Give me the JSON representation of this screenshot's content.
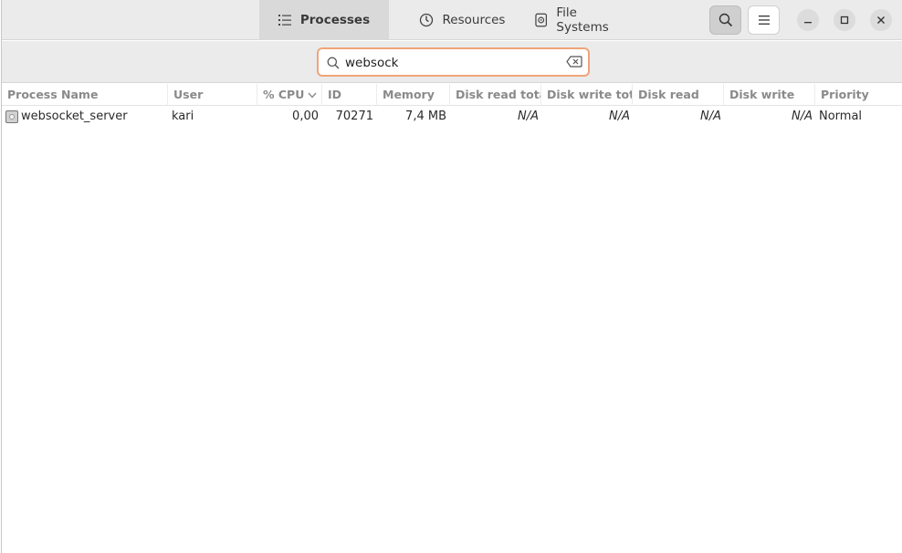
{
  "tabs": [
    {
      "label": "Processes",
      "icon": "list-icon",
      "active": true
    },
    {
      "label": "Resources",
      "icon": "gauge-icon",
      "active": false
    },
    {
      "label": "File Systems",
      "icon": "disk-icon",
      "active": false
    }
  ],
  "search": {
    "value": "websock",
    "placeholder": ""
  },
  "columns": [
    "Process Name",
    "User",
    "% CPU",
    "ID",
    "Memory",
    "Disk read total",
    "Disk write tota",
    "Disk read",
    "Disk write",
    "Priority"
  ],
  "rows": [
    {
      "name": "websocket_server",
      "user": "kari",
      "cpu": "0,00",
      "id": "70271",
      "memory": "7,4 MB",
      "disk_read_total": "N/A",
      "disk_write_total": "N/A",
      "disk_read": "N/A",
      "disk_write": "N/A",
      "priority": "Normal"
    }
  ],
  "colors": {
    "accent": "#f0a47a",
    "header_bg": "#ebebeb",
    "active_tab_bg": "#d9d9d9"
  }
}
